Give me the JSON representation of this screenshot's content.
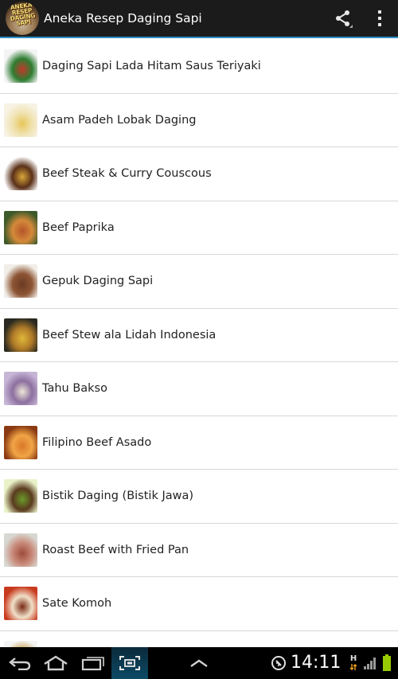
{
  "app": {
    "title": "Aneka Resep Daging Sapi",
    "logo_text": "ANEKA RESEP DAGING SAPI",
    "accent": "#2f8ec4"
  },
  "actions": {
    "share_icon": "share-icon",
    "overflow_icon": "overflow-menu-icon"
  },
  "recipes": [
    {
      "label": "Daging Sapi Lada Hitam Saus Teriyaki",
      "thumb": [
        "#f4f4f4",
        "#c0392b",
        "#2e7d32"
      ]
    },
    {
      "label": "Asam Padeh Lobak Daging",
      "thumb": [
        "#f7f2e3",
        "#e8c65a",
        "#f0e2b0"
      ]
    },
    {
      "label": "Beef Steak & Curry Couscous",
      "thumb": [
        "#ffffff",
        "#d9a63a",
        "#5a3018"
      ]
    },
    {
      "label": "Beef Paprika",
      "thumb": [
        "#3d5a2a",
        "#b5552a",
        "#d48a3a"
      ]
    },
    {
      "label": "Gepuk Daging Sapi",
      "thumb": [
        "#f1eee8",
        "#6b3a22",
        "#8d5535"
      ]
    },
    {
      "label": "Beef Stew ala Lidah Indonesia",
      "thumb": [
        "#2a2a20",
        "#e0b83a",
        "#b07a28"
      ]
    },
    {
      "label": "Tahu Bakso",
      "thumb": [
        "#c7b5d6",
        "#efe6d8",
        "#8c6f9e"
      ]
    },
    {
      "label": "Filipino Beef Asado",
      "thumb": [
        "#8a3a12",
        "#d9782a",
        "#f1a546"
      ]
    },
    {
      "label": "Bistik Daging (Bistik Jawa)",
      "thumb": [
        "#e9f2c8",
        "#6a9a2a",
        "#5a3a1e"
      ]
    },
    {
      "label": "Roast Beef with Fried Pan",
      "thumb": [
        "#d8d8d2",
        "#9e4a3a",
        "#c98a7a"
      ]
    },
    {
      "label": "Sate Komoh",
      "thumb": [
        "#c83a1e",
        "#7a2a14",
        "#f0e0c8"
      ]
    },
    {
      "label": "",
      "thumb": [
        "#f4f4f4",
        "#4a8a2a",
        "#c8a050"
      ]
    }
  ],
  "status": {
    "time": "14:11",
    "network": "H",
    "battery_color": "#99cc00"
  },
  "nav": {
    "back_icon": "back-icon",
    "home_icon": "home-icon",
    "recent_icon": "recent-apps-icon",
    "screenshot_icon": "screenshot-icon",
    "menu_icon": "menu-up-icon"
  }
}
